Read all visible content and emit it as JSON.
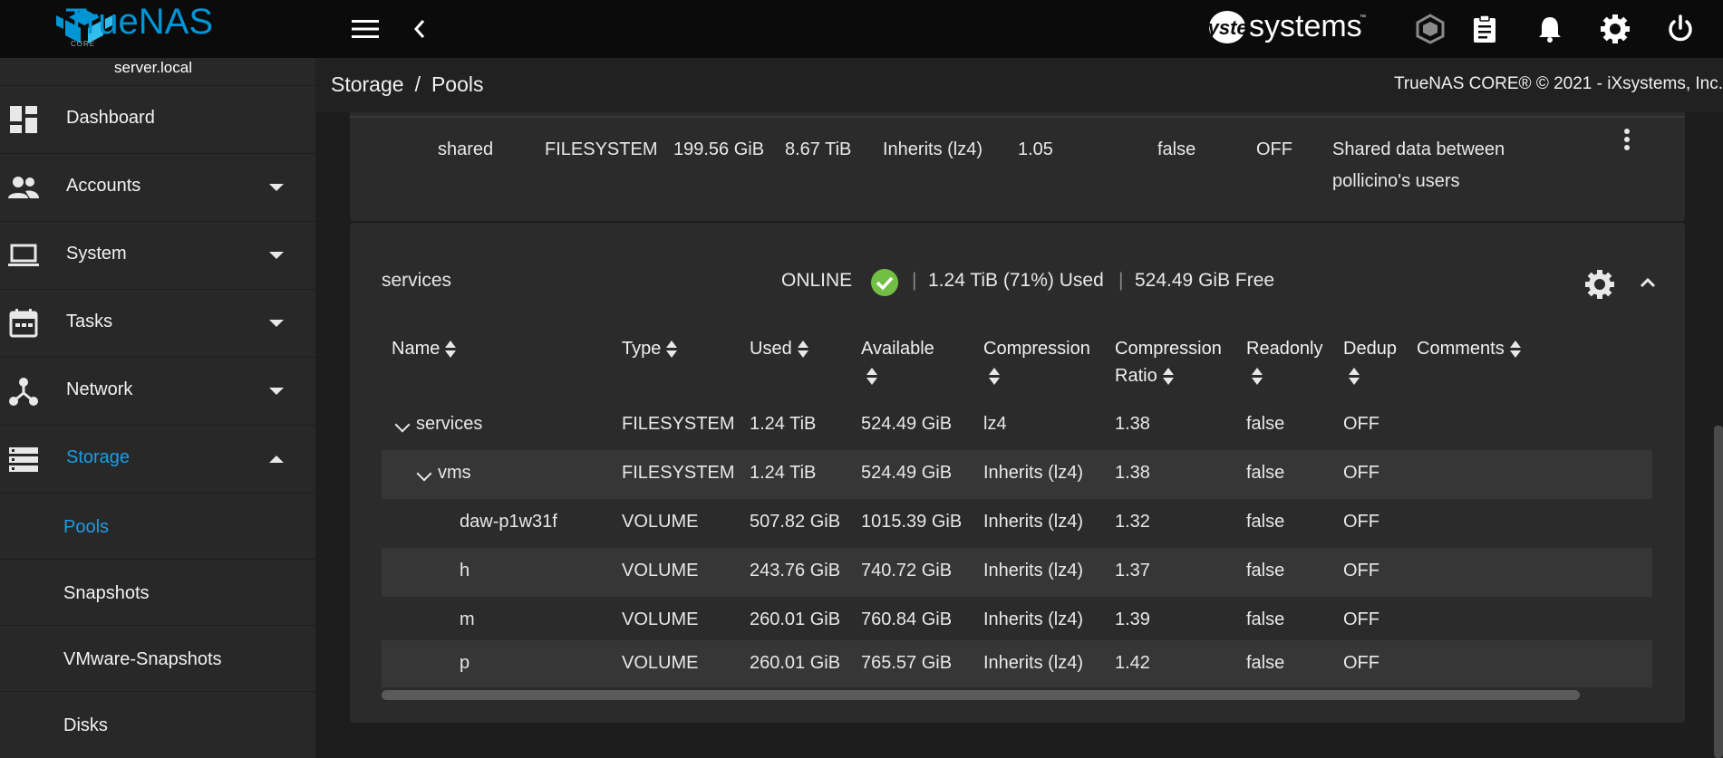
{
  "app": {
    "product": "TrueNAS",
    "edition": "CORE",
    "vendor_logo": "iXsystems",
    "vendor_wordmark": "systems",
    "hostname": "server.local"
  },
  "topbar_icons": [
    "menu-icon",
    "back-chevron-icon",
    "truecommand-icon",
    "clipboard-icon",
    "bell-icon",
    "gear-icon",
    "power-icon"
  ],
  "breadcrumb": {
    "parent": "Storage",
    "separator": "/",
    "current": "Pools"
  },
  "copyright": "TrueNAS CORE® © 2021 - iXsystems, Inc.",
  "sidebar": {
    "items": [
      {
        "label": "Dashboard",
        "icon": "dashboard-icon",
        "expandable": false
      },
      {
        "label": "Accounts",
        "icon": "people-icon",
        "expandable": true
      },
      {
        "label": "System",
        "icon": "laptop-icon",
        "expandable": true
      },
      {
        "label": "Tasks",
        "icon": "calendar-icon",
        "expandable": true
      },
      {
        "label": "Network",
        "icon": "network-icon",
        "expandable": true
      },
      {
        "label": "Storage",
        "icon": "storage-icon",
        "expandable": true,
        "active": true
      }
    ],
    "subitems": [
      {
        "label": "Pools",
        "active": true
      },
      {
        "label": "Snapshots"
      },
      {
        "label": "VMware-Snapshots"
      },
      {
        "label": "Disks"
      }
    ]
  },
  "prev_dataset_row": {
    "name": "shared",
    "type": "FILESYSTEM",
    "used": "199.56 GiB",
    "available": "8.67 TiB",
    "compression": "Inherits (lz4)",
    "ratio": "1.05",
    "readonly": "false",
    "dedup": "OFF",
    "comments_line1": "Shared data between",
    "comments_line2": "pollicino's users"
  },
  "pool": {
    "name": "services",
    "status": "ONLINE",
    "used": "1.24 TiB (71%) Used",
    "free": "524.49 GiB Free",
    "divider": "|"
  },
  "table": {
    "headers": {
      "name": "Name",
      "type": "Type",
      "used": "Used",
      "available": "Available",
      "compression": "Compression",
      "ratio_l1": "Compression",
      "ratio_l2": "Ratio",
      "readonly": "Readonly",
      "dedup": "Dedup",
      "comments": "Comments"
    },
    "rows": [
      {
        "name": "services",
        "type": "FILESYSTEM",
        "used": "1.24 TiB",
        "available": "524.49 GiB",
        "compression": "lz4",
        "ratio": "1.38",
        "readonly": "false",
        "dedup": "OFF"
      },
      {
        "name": "vms",
        "type": "FILESYSTEM",
        "used": "1.24 TiB",
        "available": "524.49 GiB",
        "compression": "Inherits (lz4)",
        "ratio": "1.38",
        "readonly": "false",
        "dedup": "OFF"
      },
      {
        "name": "daw-p1w31f",
        "type": "VOLUME",
        "used": "507.82 GiB",
        "available": "1015.39 GiB",
        "compression": "Inherits (lz4)",
        "ratio": "1.32",
        "readonly": "false",
        "dedup": "OFF"
      },
      {
        "name": "h",
        "type": "VOLUME",
        "used": "243.76 GiB",
        "available": "740.72 GiB",
        "compression": "Inherits (lz4)",
        "ratio": "1.37",
        "readonly": "false",
        "dedup": "OFF"
      },
      {
        "name": "m",
        "type": "VOLUME",
        "used": "260.01 GiB",
        "available": "760.84 GiB",
        "compression": "Inherits (lz4)",
        "ratio": "1.39",
        "readonly": "false",
        "dedup": "OFF"
      },
      {
        "name": "p",
        "type": "VOLUME",
        "used": "260.01 GiB",
        "available": "765.57 GiB",
        "compression": "Inherits (lz4)",
        "ratio": "1.42",
        "readonly": "false",
        "dedup": "OFF"
      }
    ]
  },
  "colors": {
    "accent": "#1a9ee5",
    "online": "#71bf44",
    "topbar": "#0b0b0b",
    "sidebar": "#282828"
  }
}
